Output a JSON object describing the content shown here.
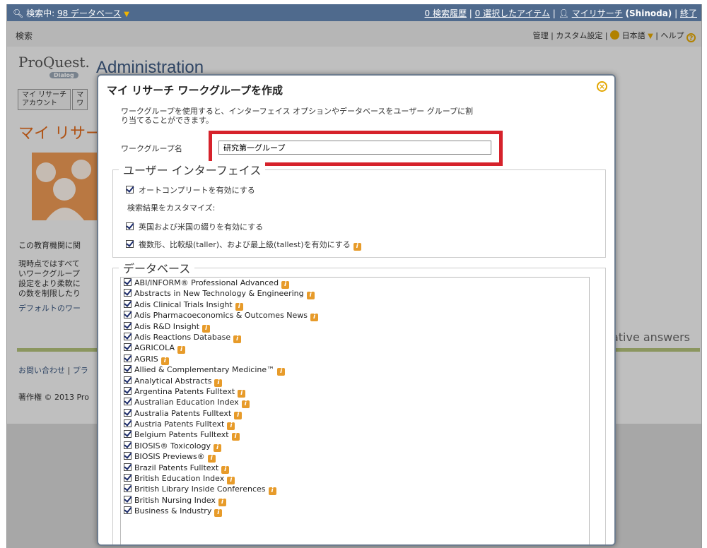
{
  "topbar": {
    "search_prefix": "検索中:",
    "db_link": "98 データベース",
    "history": "0 検索履歴",
    "selected": "0 選択したアイテム",
    "myresearch": "マイリサーチ",
    "user": "(Shinoda)",
    "logout": "終了",
    "sep": "|"
  },
  "subbar": {
    "search": "検索",
    "admin": "管理",
    "custom": "カスタム設定",
    "lang": "日本語",
    "help": "ヘルプ",
    "sep": "|"
  },
  "logo": {
    "name": "ProQuest.",
    "sub": "Dialog"
  },
  "page": {
    "admin_title": "Administration",
    "tab1_line1": "マイ リサーチ",
    "tab1_line2": "アカウント",
    "tab2_line1": "マ",
    "tab2_line2": "ワ",
    "heading": "マイ リサー",
    "bg_text1": "この教育機関に関",
    "bg_text2a": "現時点ではすべて",
    "bg_text2b": "いワークグループ",
    "bg_text2c": "設定をより柔軟に",
    "bg_text2d": "の数を制限したり",
    "bg_link": "デフォルトのワー",
    "tagline": "ritative answers",
    "footer_contact": "お問い合わせ",
    "footer_sep": "|",
    "footer_priv": "プラ",
    "copyright": "著作権 © 2013 Pro"
  },
  "modal": {
    "title": "マイ リサーチ ワークグループを作成",
    "close_icon": "close-circle-icon",
    "desc_line1": "ワークグループを使用すると、インターフェイス オプションやデータベースをユーザー グループに割",
    "desc_line2": "り当てることができます。",
    "wg_label": "ワークグループ名",
    "wg_value": "研究第一グループ",
    "ui_legend": "ユーザー インターフェイス",
    "autocomplete": "オートコンプリートを有効にする",
    "customize": "検索結果をカスタマイズ:",
    "spelling": "英国および米国の綴りを有効にする",
    "comparatives": "複数形、比較級(taller)、および最上級(tallest)を有効にする",
    "db_legend": "データベース",
    "info_glyph": "i",
    "databases": [
      "ABI/INFORM® Professional Advanced",
      "Abstracts in New Technology & Engineering",
      "Adis Clinical Trials Insight",
      "Adis Pharmacoeconomics & Outcomes News",
      "Adis R&D Insight",
      "Adis Reactions Database",
      "AGRICOLA",
      "AGRIS",
      "Allied & Complementary Medicine™",
      "Analytical Abstracts",
      "Argentina Patents Fulltext",
      "Australian Education Index",
      "Australia Patents Fulltext",
      "Austria Patents Fulltext",
      "Belgium Patents Fulltext",
      "BIOSIS® Toxicology",
      "BIOSIS Previews®",
      "Brazil Patents Fulltext",
      "British Education Index",
      "British Library Inside Conferences",
      "British Nursing Index",
      "Business & Industry"
    ]
  },
  "colors": {
    "topbar": "#4f6a8d",
    "accent_orange": "#e06a1a",
    "highlight_red": "#d6222b",
    "info_orange": "#e79b2a"
  }
}
